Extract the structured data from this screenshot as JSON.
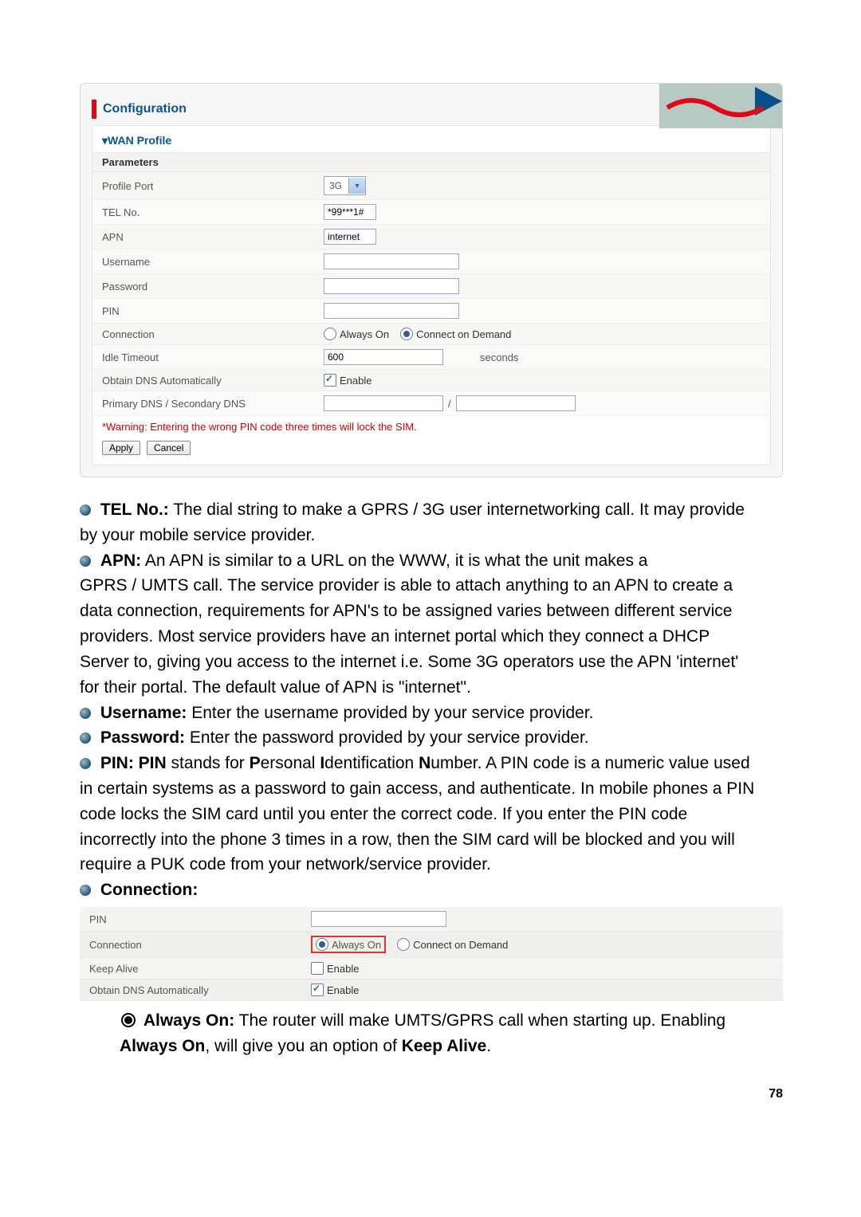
{
  "shot1": {
    "header": "Configuration",
    "section": "▾WAN Profile",
    "parameters": "Parameters",
    "rows": {
      "profile_port": {
        "label": "Profile Port",
        "value": "3G"
      },
      "tel_no": {
        "label": "TEL No.",
        "value": "*99***1#"
      },
      "apn": {
        "label": "APN",
        "value": "internet"
      },
      "username": {
        "label": "Username",
        "value": ""
      },
      "password": {
        "label": "Password",
        "value": ""
      },
      "pin": {
        "label": "PIN",
        "value": ""
      },
      "connection": {
        "label": "Connection",
        "opt_always": "Always On",
        "opt_demand": "Connect on Demand"
      },
      "idle": {
        "label": "Idle Timeout",
        "value": "600",
        "unit": "seconds"
      },
      "dns_auto": {
        "label": "Obtain DNS Automatically",
        "opt": "Enable"
      },
      "dns_pair": {
        "label": "Primary DNS / Secondary DNS",
        "sep": "/"
      }
    },
    "warning": "*Warning: Entering the wrong PIN code three times will lock the SIM.",
    "btn_apply": "Apply",
    "btn_cancel": "Cancel"
  },
  "text": {
    "tel_term": "TEL No.:",
    "tel_a": " The dial string to make a GPRS / 3G user internetworking call. It may provide",
    "tel_b": "by your mobile service provider.",
    "apn_term": "APN:",
    "apn_a": " An APN is similar to a URL on the WWW, it is what the unit makes a",
    "apn_b1": "GPRS / UMTS call. The service provider is able to attach anything to an APN to create a",
    "apn_b2": "data connection, requirements for APN's to be assigned varies between different service",
    "apn_b3": "providers. Most service providers have an internet portal which they connect a DHCP",
    "apn_b4": "Server to, giving you access to the internet i.e. Some 3G operators use the APN 'internet'",
    "apn_b5": "for their portal. The default value of APN is \"internet\".",
    "user_term": "Username:",
    "user_a": " Enter the username provided by your service provider.",
    "pass_term": "Password:",
    "pass_a": " Enter the password provided by your service provider.",
    "pin_term": "PIN:",
    "pin_lead": " PIN",
    "pin_a1": " stands for ",
    "pin_p": "P",
    "pin_ersonal": "ersonal ",
    "pin_i": "I",
    "pin_dent": "dentification ",
    "pin_n": "N",
    "pin_umber": "umber. A PIN code is a numeric value used",
    "pin_b1": "in certain systems as a password to gain access, and authenticate. In mobile phones a PIN",
    "pin_b2": "code locks the SIM card until you enter the correct code. If you enter the PIN code",
    "pin_b3": "incorrectly into the phone 3 times in a row, then the SIM card will be blocked and you will",
    "pin_b4": "require a PUK code from your network/service provider.",
    "conn_term": "Connection:"
  },
  "shot2": {
    "rows": {
      "pin": {
        "label": "PIN"
      },
      "connection": {
        "label": "Connection",
        "opt_always": "Always On",
        "opt_demand": "Connect on Demand"
      },
      "keep": {
        "label": "Keep Alive",
        "opt": "Enable"
      },
      "dns_auto": {
        "label": "Obtain DNS Automatically",
        "opt": "Enable"
      }
    }
  },
  "sub": {
    "always_term": "Always On:",
    "always_a": " The router will make UMTS/GPRS call when starting up. Enabling",
    "always_b1": "Always On",
    "always_b2": ", will give you an option of ",
    "always_b3": "Keep Alive",
    "always_b4": "."
  },
  "pagenum": "78"
}
